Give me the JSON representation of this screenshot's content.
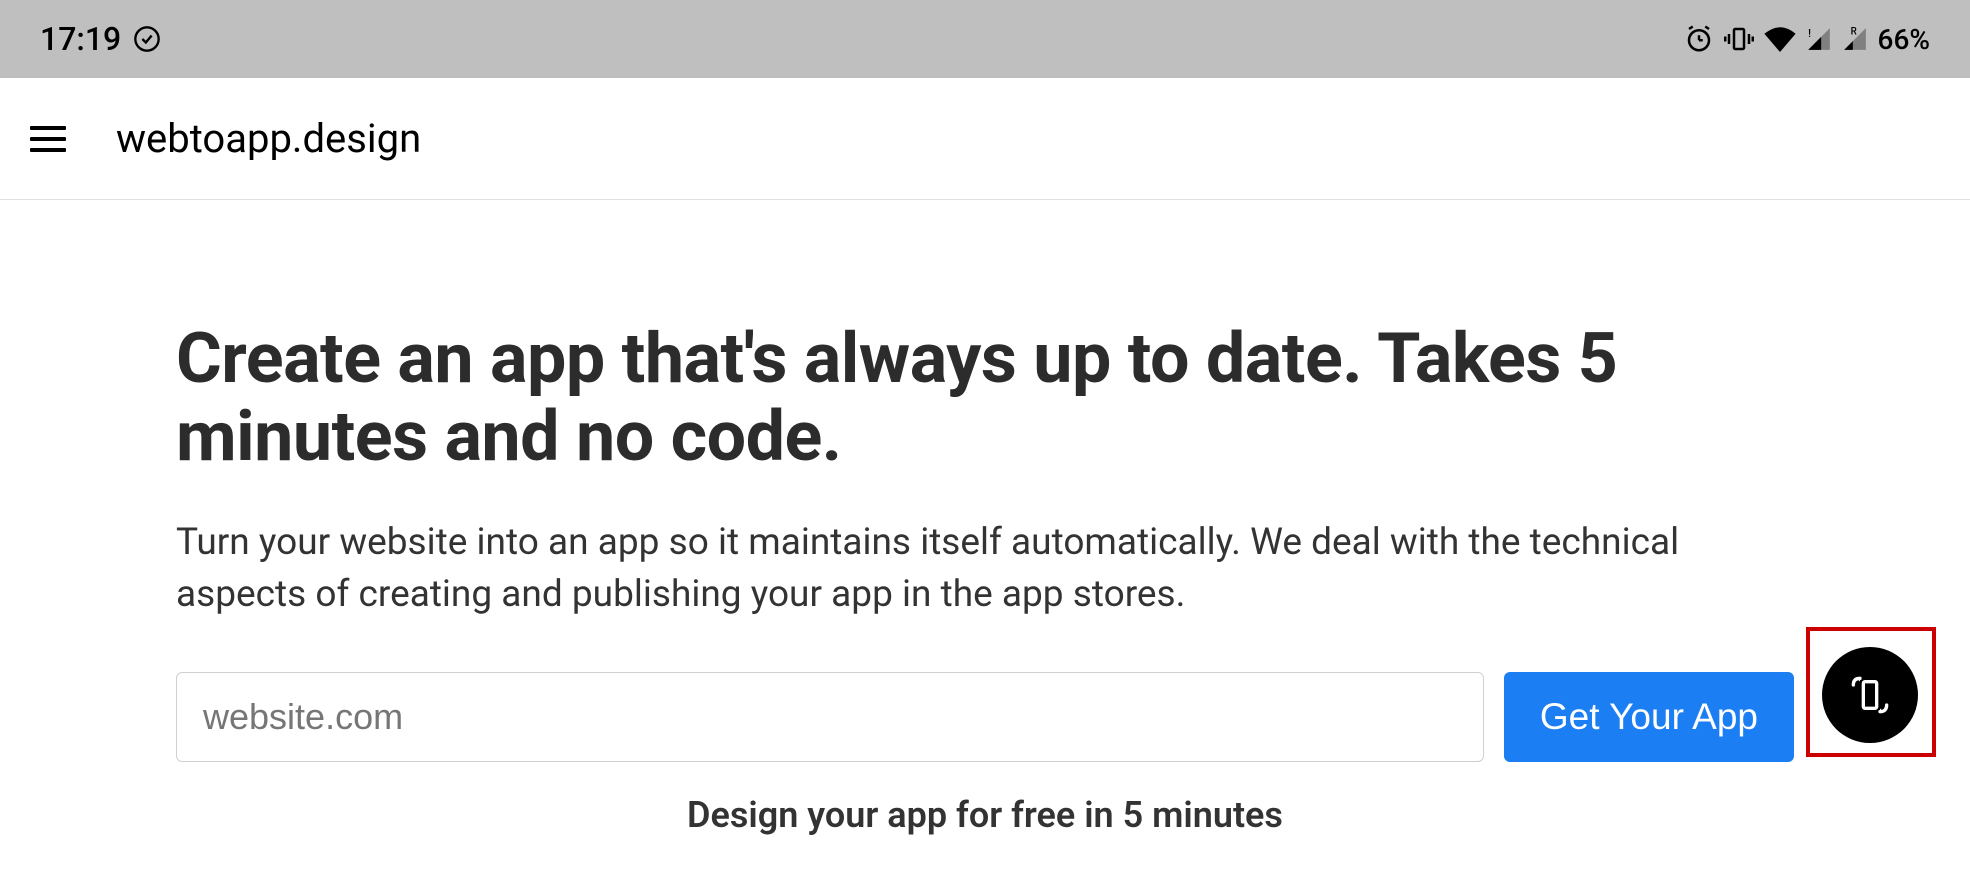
{
  "status_bar": {
    "time": "17:19",
    "battery_percent": "66%"
  },
  "app_bar": {
    "title": "webtoapp.design"
  },
  "main": {
    "headline": "Create an app that's always up to date. Takes 5 minutes and no code.",
    "subheadline": "Turn your website into an app so it maintains itself automatically. We deal with the technical aspects of creating and publishing your app in the app stores.",
    "input_placeholder": "website.com",
    "cta_label": "Get Your App",
    "bottom_text": "Design your app for free in 5 minutes"
  }
}
